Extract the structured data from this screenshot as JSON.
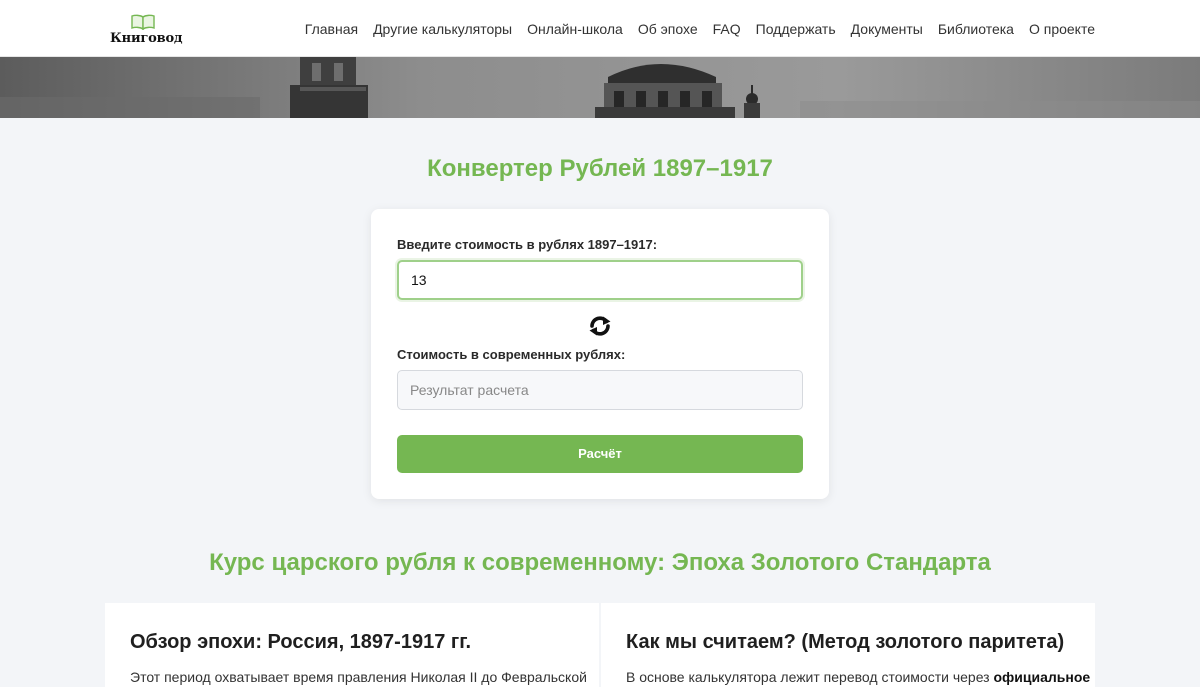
{
  "header": {
    "logo_text": "Книговод",
    "nav": [
      "Главная",
      "Другие калькуляторы",
      "Онлайн-школа",
      "Об эпохе",
      "FAQ",
      "Поддержать",
      "Документы",
      "Библиотека",
      "О проекте"
    ]
  },
  "converter": {
    "title": "Конвертер Рублей 1897–1917",
    "input_label": "Введите стоимость в рублях 1897–1917:",
    "input_value": "13",
    "result_label": "Стоимость в современных рублях:",
    "result_placeholder": "Результат расчета",
    "button_label": "Расчёт"
  },
  "info": {
    "title": "Курс царского рубля к современному: Эпоха Золотого Стандарта",
    "card1": {
      "title": "Обзор эпохи: Россия, 1897-1917 гг.",
      "text": "Этот период охватывает время правления Николая II до Февральской"
    },
    "card2": {
      "title": "Как мы считаем? (Метод золотого паритета)",
      "text": "В основе калькулятора лежит перевод стоимости через ",
      "text_bold": "официальное"
    }
  },
  "colors": {
    "accent": "#75b752",
    "page_bg": "#f3f5f8"
  },
  "icons": {
    "logo": "open-book-icon",
    "swap": "refresh-icon"
  }
}
